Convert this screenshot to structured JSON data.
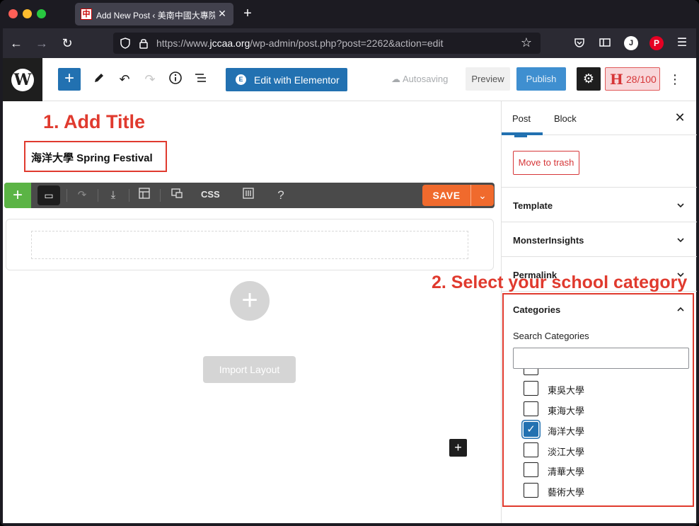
{
  "browser": {
    "tab_title": "Add New Post ‹ 美南中國大專院校",
    "tab_favicon": "中",
    "url_prefix": "https://www.",
    "url_domain": "jccaa.org",
    "url_path": "/wp-admin/post.php?post=2262&action=edit",
    "account_initial": "J",
    "pinterest_letter": "P"
  },
  "header": {
    "wp_logo": "W",
    "elementor_label": "Edit with Elementor",
    "autosave_label": "Autosaving",
    "preview_label": "Preview",
    "publish_label": "Publish",
    "score_letter": "H",
    "score_value": "28/100"
  },
  "editor": {
    "annotation_1": "1. Add Title",
    "post_title": "海洋大學 Spring Festival",
    "toolbar": {
      "css_label": "CSS",
      "help_label": "?",
      "save_label": "SAVE"
    },
    "import_label": "Import Layout"
  },
  "sidebar": {
    "tab_post": "Post",
    "tab_block": "Block",
    "trash_label": "Move to trash",
    "panels": {
      "template": "Template",
      "monsterinsights": "MonsterInsights",
      "permalink": "Permalink",
      "categories": "Categories"
    },
    "annotation_2": "2. Select your school category",
    "search_label": "Search Categories",
    "categories": [
      {
        "label": "東吳大學",
        "checked": false
      },
      {
        "label": "東海大學",
        "checked": false
      },
      {
        "label": "海洋大學",
        "checked": true
      },
      {
        "label": "淡江大學",
        "checked": false
      },
      {
        "label": "清華大學",
        "checked": false
      },
      {
        "label": "藝術大學",
        "checked": false
      }
    ]
  },
  "colors": {
    "accent": "#2271b1",
    "annotation": "#e03a2e",
    "elementor_save": "#f06a2d",
    "elementor_add": "#5bb445"
  }
}
